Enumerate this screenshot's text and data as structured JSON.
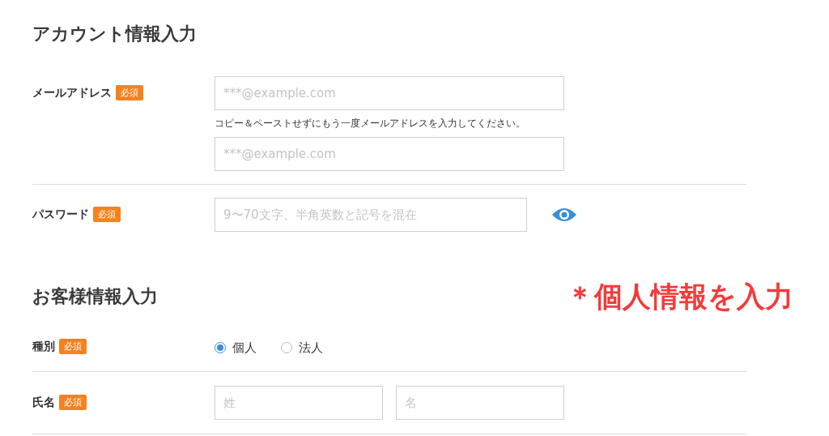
{
  "sections": [
    {
      "title": "アカウント情報入力",
      "rows": [
        {
          "label": "メールアドレス",
          "badge": "必須",
          "divider": true,
          "items": [
            {
              "kind": "input",
              "placeholder": "***@example.com"
            },
            {
              "kind": "note",
              "text": "コピー＆ペーストせずにもう一度メールアドレスを入力してください。"
            },
            {
              "kind": "input",
              "placeholder": "***@example.com"
            }
          ]
        },
        {
          "label": "パスワード",
          "badge": "必須",
          "divider": false,
          "items": [
            {
              "kind": "password",
              "placeholder": "9〜70文字、半角英数と記号を混在"
            }
          ]
        }
      ]
    },
    {
      "title": "お客様情報入力",
      "annotation": "＊個人情報を入力",
      "rows": [
        {
          "label": "種別",
          "badge": "必須",
          "divider": true,
          "items": [
            {
              "kind": "radios",
              "options": [
                {
                  "label": "個人",
                  "selected": true
                },
                {
                  "label": "法人",
                  "selected": false
                }
              ]
            }
          ]
        },
        {
          "label": "氏名",
          "badge": "必須",
          "divider": true,
          "items": [
            {
              "kind": "pair",
              "placeholders": [
                "姓",
                "名"
              ]
            }
          ]
        }
      ]
    }
  ]
}
